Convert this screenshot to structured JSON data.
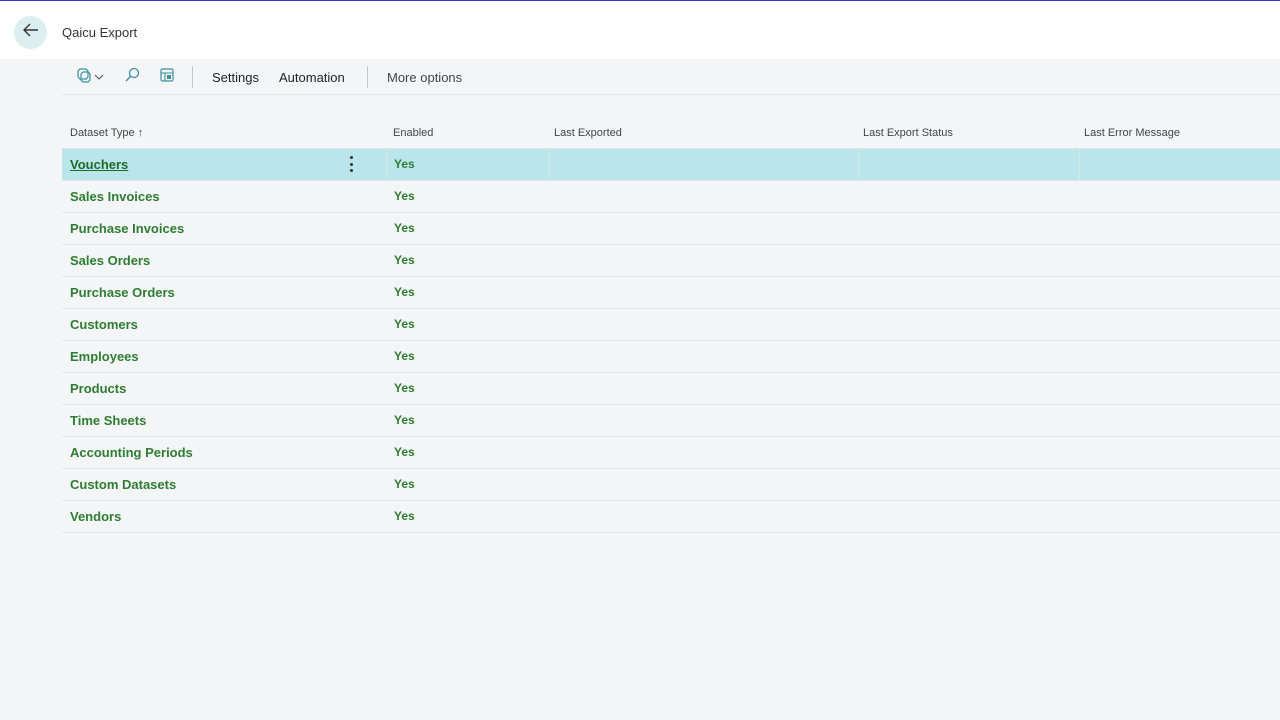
{
  "header": {
    "title": "Qaicu Export",
    "back_icon": "arrow-left-icon"
  },
  "toolbar": {
    "icons": [
      "copilot-icon",
      "chevron-down-icon",
      "search-icon",
      "edit-list-icon"
    ],
    "settings_label": "Settings",
    "automation_label": "Automation",
    "more_options_label": "More options"
  },
  "table": {
    "columns": {
      "dataset_type": "Dataset Type",
      "sort_indicator": "↑",
      "enabled": "Enabled",
      "last_exported": "Last Exported",
      "last_export_status": "Last Export Status",
      "last_error_message": "Last Error Message"
    },
    "rows": [
      {
        "name": "Vouchers",
        "enabled": "Yes"
      },
      {
        "name": "Sales Invoices",
        "enabled": "Yes"
      },
      {
        "name": "Purchase Invoices",
        "enabled": "Yes"
      },
      {
        "name": "Sales Orders",
        "enabled": "Yes"
      },
      {
        "name": "Purchase Orders",
        "enabled": "Yes"
      },
      {
        "name": "Customers",
        "enabled": "Yes"
      },
      {
        "name": "Employees",
        "enabled": "Yes"
      },
      {
        "name": "Products",
        "enabled": "Yes"
      },
      {
        "name": "Time Sheets",
        "enabled": "Yes"
      },
      {
        "name": "Accounting Periods",
        "enabled": "Yes"
      },
      {
        "name": "Custom Datasets",
        "enabled": "Yes"
      },
      {
        "name": "Vendors",
        "enabled": "Yes"
      }
    ],
    "selected_row": 0
  },
  "colors": {
    "accent_line": "#3b2fd6",
    "link_green": "#2e7d32",
    "selected_row": "#b8e6ec"
  }
}
